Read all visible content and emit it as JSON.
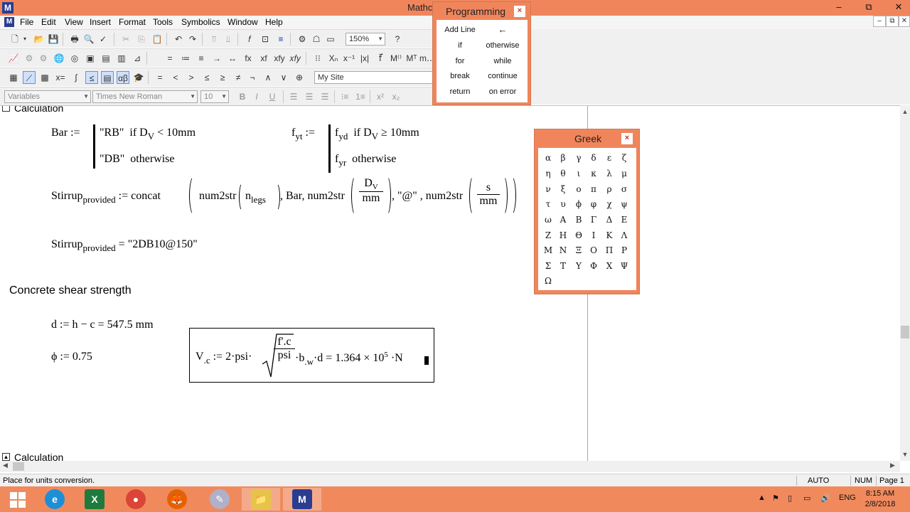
{
  "titlebar": {
    "title": "Mathc",
    "app_icon_glyph": "M",
    "min": "–",
    "restore": "⧉",
    "close": "✕"
  },
  "menu": {
    "items": [
      "File",
      "Edit",
      "View",
      "Insert",
      "Format",
      "Tools",
      "Symbolics",
      "Window",
      "Help"
    ],
    "doc_min": "–",
    "doc_restore": "⧉",
    "doc_close": "✕"
  },
  "toolbar": {
    "zoom": "150%",
    "resource": "My Site",
    "style": "Variables",
    "font": "Times New Roman",
    "size": "10",
    "bold": "B",
    "italic": "I",
    "underline": "U"
  },
  "document": {
    "region_top_label": "Calculation",
    "region_bottom_label": "Calculation",
    "bar_def": {
      "lhs": "Bar :=",
      "row1_val": "\"RB\"",
      "row1_cond": "if D",
      "row1_sub": "V",
      "row1_rel": "< 10mm",
      "row2_val": "\"DB\"",
      "row2_cond": "otherwise"
    },
    "fyt_def": {
      "lhs_main": "f",
      "lhs_sub": "yt",
      "assign": ":=",
      "row1_val": "f",
      "row1_val_sub": "yd",
      "row1_cond": "if D",
      "row1_sub": "V",
      "row1_rel": "≥ 10mm",
      "row2_val": "f",
      "row2_val_sub": "yr",
      "row2_cond": "otherwise"
    },
    "stirrup_def": {
      "lhs_main": "Stirrup",
      "lhs_sub": "provided",
      "concat": ":= concat",
      "num2str_1": "num2str",
      "n_main": "n",
      "n_sub": "legs",
      "mid": ", Bar, num2str",
      "dv_num_main": "D",
      "dv_num_sub": "V",
      "dv_den": "mm",
      "at": ", \"@\" , num2str",
      "s_num": "s",
      "s_den": "mm"
    },
    "stirrup_result": {
      "lhs_main": "Stirrup",
      "lhs_sub": "provided",
      "rhs": "= \"2DB10@150\""
    },
    "heading": "Concrete shear strength",
    "d_def": "d := h − c = 547.5 mm",
    "phi_def": "ϕ := 0.75",
    "vc_def": {
      "lhs_main": "V",
      "lhs_sub": ".c",
      "assign": ":= 2·psi·",
      "frac_num": "f'.c",
      "frac_den": "psi",
      "tail_b": "·b",
      "tail_b_sub": ".w",
      "tail_d": "·d = 1.364 × 10",
      "exp": "5",
      "unit": "·N"
    }
  },
  "status": {
    "message": "Place for units conversion.",
    "auto": "AUTO",
    "num": "NUM",
    "page": "Page 1"
  },
  "taskbar": {
    "lang": "ENG",
    "time": "8:15 AM",
    "date": "2/8/2018"
  },
  "programming": {
    "title": "Programming",
    "close": "×",
    "items": [
      [
        "Add Line",
        "←"
      ],
      [
        "if",
        "otherwise"
      ],
      [
        "for",
        "while"
      ],
      [
        "break",
        "continue"
      ],
      [
        "return",
        "on error"
      ]
    ]
  },
  "greek": {
    "title": "Greek",
    "close": "×",
    "rows": [
      [
        "α",
        "β",
        "γ",
        "δ",
        "ε",
        "ζ"
      ],
      [
        "η",
        "θ",
        "ι",
        "κ",
        "λ",
        "μ"
      ],
      [
        "ν",
        "ξ",
        "ο",
        "π",
        "ρ",
        "σ"
      ],
      [
        "τ",
        "υ",
        "ϕ",
        "φ",
        "χ",
        "ψ"
      ],
      [
        "ω",
        "Α",
        "Β",
        "Γ",
        "Δ",
        "Ε"
      ],
      [
        "Ζ",
        "Η",
        "Θ",
        "Ι",
        "Κ",
        "Λ"
      ],
      [
        "Μ",
        "Ν",
        "Ξ",
        "Ο",
        "Π",
        "Ρ"
      ],
      [
        "Σ",
        "Τ",
        "Υ",
        "Φ",
        "Χ",
        "Ψ"
      ],
      [
        "Ω"
      ]
    ]
  },
  "colors": {
    "accent": "#f0855c",
    "taskbar": "#f08a5d"
  }
}
